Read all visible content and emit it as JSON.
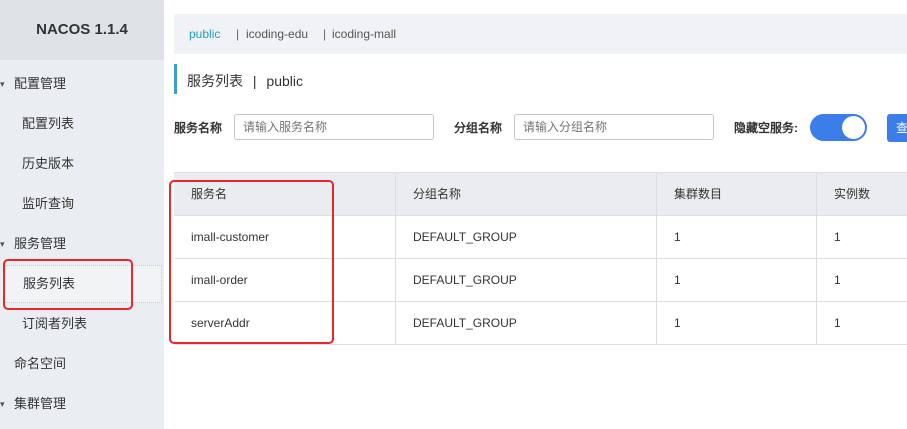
{
  "app": {
    "brand": "NACOS 1.1.4"
  },
  "sidebar": {
    "groups": [
      {
        "label": "配置管理",
        "items": [
          "配置列表",
          "历史版本",
          "监听查询"
        ]
      },
      {
        "label": "服务管理",
        "items": [
          "服务列表",
          "订阅者列表"
        ]
      },
      {
        "label": "命名空间",
        "items": []
      },
      {
        "label": "集群管理",
        "items": []
      }
    ],
    "active_item": "服务列表"
  },
  "namespaces": {
    "tabs": [
      "public",
      "icoding-edu",
      "icoding-mall"
    ],
    "separator": "|",
    "active": "public"
  },
  "page": {
    "title": "服务列表",
    "separator": "|",
    "namespace": "public"
  },
  "filters": {
    "service_name_label": "服务名称",
    "service_name_placeholder": "请输入服务名称",
    "group_name_label": "分组名称",
    "group_name_placeholder": "请输入分组名称",
    "hide_empty_label": "隐藏空服务:",
    "hide_empty_on": true,
    "query_button": "查"
  },
  "table": {
    "columns": [
      "服务名",
      "分组名称",
      "集群数目",
      "实例数"
    ],
    "rows": [
      [
        "imall-customer",
        "DEFAULT_GROUP",
        "1",
        "1"
      ],
      [
        "imall-order",
        "DEFAULT_GROUP",
        "1",
        "1"
      ],
      [
        "serverAddr",
        "DEFAULT_GROUP",
        "1",
        "1"
      ]
    ]
  },
  "colors": {
    "accent": "#3b7de9",
    "namespace_active": "#20a0c6",
    "annotation": "#e8262c",
    "sidebar_bg": "#eaedf1"
  }
}
